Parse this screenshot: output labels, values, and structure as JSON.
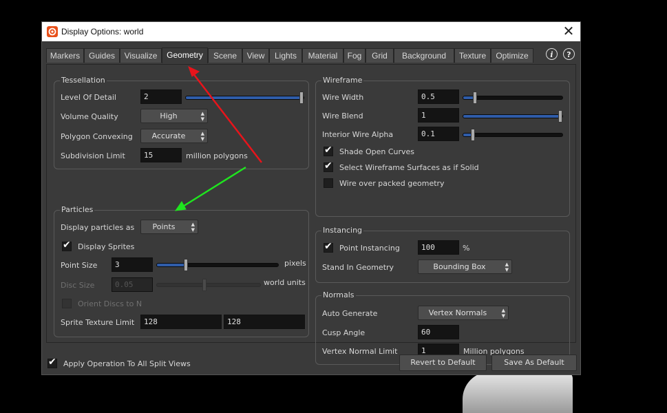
{
  "window": {
    "title": "Display Options:  world",
    "close_symbol": "✕"
  },
  "tabs": [
    "Markers",
    "Guides",
    "Visualize",
    "Geometry",
    "Scene",
    "View",
    "Lights",
    "Material",
    "Fog",
    "Grid",
    "Background",
    "Texture",
    "Optimize"
  ],
  "active_tab": "Geometry",
  "help": {
    "info": "i",
    "question": "?"
  },
  "tessellation": {
    "title": "Tessellation",
    "level_of_detail": {
      "label": "Level Of Detail",
      "value": "2",
      "slider": 1.0
    },
    "volume_quality": {
      "label": "Volume Quality",
      "value": "High"
    },
    "polygon_convexing": {
      "label": "Polygon Convexing",
      "value": "Accurate"
    },
    "subdivision_limit": {
      "label": "Subdivision Limit",
      "value": "15",
      "unit": "million polygons"
    }
  },
  "particles": {
    "title": "Particles",
    "display_as": {
      "label": "Display particles as",
      "value": "Points"
    },
    "display_sprites": {
      "label": "Display Sprites",
      "checked": true
    },
    "point_size": {
      "label": "Point Size",
      "value": "3",
      "unit": "pixels",
      "slider": 0.23
    },
    "disc_size": {
      "label": "Disc Size",
      "value": "0.05",
      "unit": "world units",
      "slider": 0.46
    },
    "orient_discs": {
      "label": "Orient Discs to N",
      "checked": false
    },
    "sprite_texture_limit": {
      "label": "Sprite Texture Limit",
      "value1": "128",
      "value2": "128"
    }
  },
  "wireframe": {
    "title": "Wireframe",
    "wire_width": {
      "label": "Wire Width",
      "value": "0.5",
      "slider": 0.1
    },
    "wire_blend": {
      "label": "Wire Blend",
      "value": "1",
      "slider": 1.0
    },
    "interior_wire_alpha": {
      "label": "Interior Wire Alpha",
      "value": "0.1",
      "slider": 0.08
    },
    "shade_open_curves": {
      "label": "Shade Open Curves",
      "checked": true
    },
    "select_wireframe": {
      "label": "Select Wireframe Surfaces as if Solid",
      "checked": true
    },
    "wire_over_packed": {
      "label": "Wire over packed geometry",
      "checked": false
    }
  },
  "instancing": {
    "title": "Instancing",
    "point_instancing": {
      "label": "Point Instancing",
      "checked": true,
      "value": "100",
      "unit": "%"
    },
    "stand_in_geometry": {
      "label": "Stand In Geometry",
      "value": "Bounding Box"
    }
  },
  "normals": {
    "title": "Normals",
    "auto_generate": {
      "label": "Auto Generate",
      "value": "Vertex Normals"
    },
    "cusp_angle": {
      "label": "Cusp Angle",
      "value": "60"
    },
    "vertex_normal_limit": {
      "label": "Vertex Normal Limit",
      "value": "1",
      "unit": "Million polygons"
    }
  },
  "footer": {
    "apply_all": {
      "label": "Apply Operation To All Split Views",
      "checked": true
    },
    "revert_button": "Revert to Default",
    "save_button": "Save As Default"
  },
  "check_glyph": "✔",
  "colors": {
    "red_arrow": "#e8141b",
    "green_arrow": "#1fe41f",
    "slider_fill": "#2f5ca8"
  }
}
